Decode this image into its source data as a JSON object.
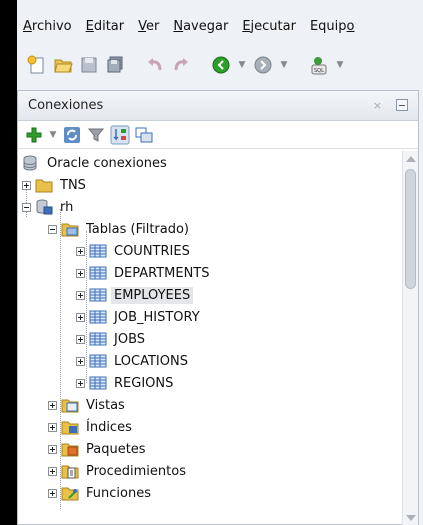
{
  "menu": {
    "items": [
      {
        "accel": "A",
        "rest": "rchivo"
      },
      {
        "accel": "E",
        "rest": "ditar"
      },
      {
        "accel": "V",
        "rest": "er"
      },
      {
        "accel": "N",
        "rest": "avegar"
      },
      {
        "accel": "E",
        "rest": "jecutar"
      },
      {
        "pre": "Equip",
        "accel": "o",
        "rest": ""
      }
    ]
  },
  "toolbar": {
    "icons": [
      "new-icon",
      "open-folder-icon",
      "save-icon",
      "save-all-icon",
      "undo-icon",
      "redo-icon",
      "back-icon",
      "forward-icon",
      "sql-worksheet-icon"
    ]
  },
  "panel": {
    "title": "Conexiones",
    "close_glyph": "×",
    "tools": [
      "add-connection-icon",
      "refresh-icon",
      "filter-icon",
      "schema-browser-icon",
      "connection-view-icon"
    ]
  },
  "tree": {
    "root": "Oracle conexiones",
    "tns": "TNS",
    "connection": "rh",
    "tables_folder": "Tablas (Filtrado)",
    "tables": [
      "COUNTRIES",
      "DEPARTMENTS",
      "EMPLOYEES",
      "JOB_HISTORY",
      "JOBS",
      "LOCATIONS",
      "REGIONS"
    ],
    "selected_table": "EMPLOYEES",
    "folders": [
      "Vistas",
      "Índices",
      "Paquetes",
      "Procedimientos",
      "Funciones"
    ]
  },
  "colors": {
    "accent_green": "#2e9e2a",
    "table_blue": "#3d6fb8",
    "folder_yellow": "#e8c04a"
  }
}
